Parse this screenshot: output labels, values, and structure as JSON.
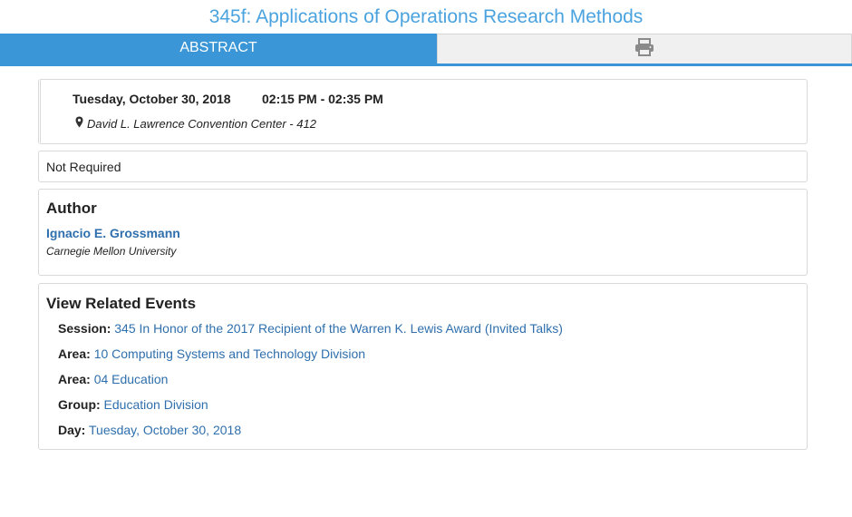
{
  "page": {
    "title": "345f: Applications of Operations Research Methods"
  },
  "tabs": {
    "abstract_label": "ABSTRACT",
    "print_icon": "printer-icon"
  },
  "schedule": {
    "date": "Tuesday, October 30, 2018",
    "time": "02:15 PM - 02:35 PM",
    "location": "David L. Lawrence Convention Center - 412",
    "location_icon": "map-marker-icon"
  },
  "presenter_status": {
    "text": "Not Required"
  },
  "author": {
    "heading": "Author",
    "name": "Ignacio E. Grossmann",
    "affiliation": "Carnegie Mellon University"
  },
  "related": {
    "heading": "View Related Events",
    "items": [
      {
        "key": "Session:",
        "value": "345 In Honor of the 2017 Recipient of the Warren K. Lewis Award (Invited Talks)"
      },
      {
        "key": "Area:",
        "value": "10 Computing Systems and Technology Division"
      },
      {
        "key": "Area:",
        "value": "04 Education"
      },
      {
        "key": "Group:",
        "value": "Education Division"
      },
      {
        "key": "Day:",
        "value": "Tuesday, October 30, 2018"
      }
    ]
  },
  "colors": {
    "accent": "#3a96d6",
    "title": "#4aa3df",
    "link": "#2f6fad"
  }
}
